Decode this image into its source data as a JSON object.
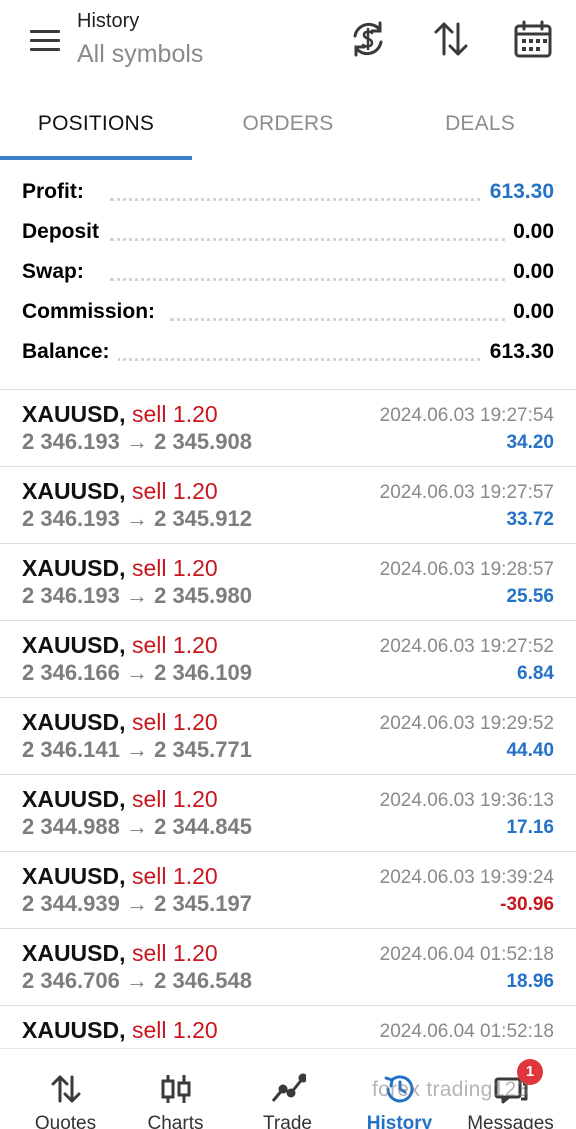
{
  "header": {
    "title_small": "History",
    "title_large": "All symbols",
    "icons": [
      "menu-icon",
      "currency-sync-icon",
      "sort-icon",
      "calendar-icon"
    ]
  },
  "tabs": [
    {
      "label": "POSITIONS",
      "active": true
    },
    {
      "label": "ORDERS",
      "active": false
    },
    {
      "label": "DEALS",
      "active": false
    }
  ],
  "summary": {
    "profit_label": "Profit:",
    "profit_value": "613.30",
    "deposit_label": "Deposit",
    "deposit_value": "0.00",
    "swap_label": "Swap:",
    "swap_value": "0.00",
    "commission_label": "Commission:",
    "commission_value": "0.00",
    "balance_label": "Balance:",
    "balance_value": "613.30"
  },
  "deals": [
    {
      "symbol": "XAUUSD,",
      "side": "sell 1.20",
      "prices": "2 346.193 → 2 345.908",
      "time": "2024.06.03 19:27:54",
      "profit": "34.20",
      "negative": false
    },
    {
      "symbol": "XAUUSD,",
      "side": "sell 1.20",
      "prices": "2 346.193 → 2 345.912",
      "time": "2024.06.03 19:27:57",
      "profit": "33.72",
      "negative": false
    },
    {
      "symbol": "XAUUSD,",
      "side": "sell 1.20",
      "prices": "2 346.193 → 2 345.980",
      "time": "2024.06.03 19:28:57",
      "profit": "25.56",
      "negative": false
    },
    {
      "symbol": "XAUUSD,",
      "side": "sell 1.20",
      "prices": "2 346.166 → 2 346.109",
      "time": "2024.06.03 19:27:52",
      "profit": "6.84",
      "negative": false
    },
    {
      "symbol": "XAUUSD,",
      "side": "sell 1.20",
      "prices": "2 346.141 → 2 345.771",
      "time": "2024.06.03 19:29:52",
      "profit": "44.40",
      "negative": false
    },
    {
      "symbol": "XAUUSD,",
      "side": "sell 1.20",
      "prices": "2 344.988 → 2 344.845",
      "time": "2024.06.03 19:36:13",
      "profit": "17.16",
      "negative": false
    },
    {
      "symbol": "XAUUSD,",
      "side": "sell 1.20",
      "prices": "2 344.939 → 2 345.197",
      "time": "2024.06.03 19:39:24",
      "profit": "-30.96",
      "negative": true
    },
    {
      "symbol": "XAUUSD,",
      "side": "sell 1.20",
      "prices": "2 346.706 → 2 346.548",
      "time": "2024.06.04 01:52:18",
      "profit": "18.96",
      "negative": false
    },
    {
      "symbol": "XAUUSD,",
      "side": "sell 1.20",
      "prices": "",
      "time": "2024.06.04 01:52:18",
      "profit": "",
      "negative": false
    }
  ],
  "bottom_nav": [
    {
      "label": "Quotes",
      "icon": "quotes-icon",
      "active": false
    },
    {
      "label": "Charts",
      "icon": "charts-icon",
      "active": false
    },
    {
      "label": "Trade",
      "icon": "trade-icon",
      "active": false
    },
    {
      "label": "History",
      "icon": "history-icon",
      "active": true
    },
    {
      "label": "Messages",
      "icon": "messages-icon",
      "active": false,
      "badge": "1"
    }
  ],
  "watermark": "forex trading123",
  "colors": {
    "accent": "#2472c8",
    "sell": "#c8161d",
    "negative": "#c8161d"
  }
}
